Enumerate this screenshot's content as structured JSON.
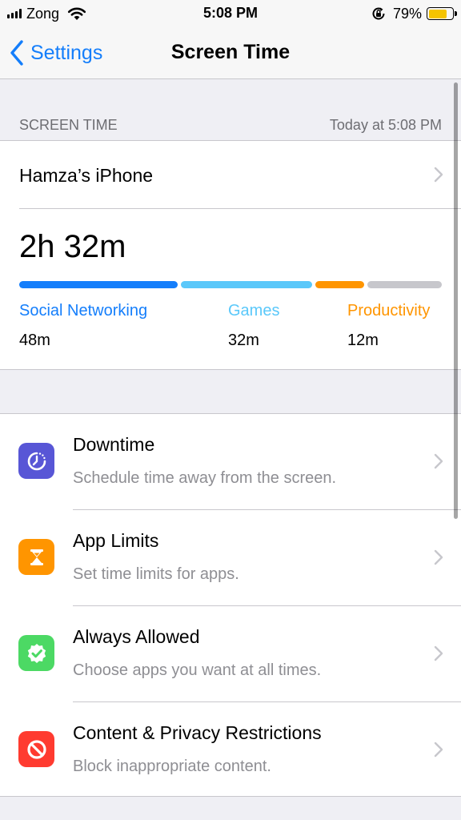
{
  "status_bar": {
    "carrier": "Zong",
    "time": "5:08 PM",
    "battery_percent": "79%",
    "battery_level": 0.79,
    "battery_color": "#f5c400",
    "icons": [
      "signal-icon",
      "wifi-icon",
      "orientation-lock-icon",
      "battery-icon"
    ]
  },
  "nav": {
    "back_label": "Settings",
    "title": "Screen Time"
  },
  "section": {
    "header": "SCREEN TIME",
    "updated": "Today at 5:08 PM"
  },
  "device": {
    "name": "Hamza’s iPhone",
    "total": "2h 32m",
    "categories": [
      {
        "label": "Social Networking",
        "value": "48m",
        "color": "#147efb"
      },
      {
        "label": "Games",
        "value": "32m",
        "color": "#5ac8fa"
      },
      {
        "label": "Productivity",
        "value": "12m",
        "color": "#ff9500"
      }
    ],
    "other_color": "#c7c7cc"
  },
  "options": [
    {
      "title": "Downtime",
      "subtitle": "Schedule time away from the screen.",
      "icon": "downtime-icon",
      "color": "#5856d6"
    },
    {
      "title": "App Limits",
      "subtitle": "Set time limits for apps.",
      "icon": "hourglass-icon",
      "color": "#ff9500"
    },
    {
      "title": "Always Allowed",
      "subtitle": "Choose apps you want at all times.",
      "icon": "checkmark-badge-icon",
      "color": "#4cd964"
    },
    {
      "title": "Content & Privacy Restrictions",
      "subtitle": "Block inappropriate content.",
      "icon": "restriction-icon",
      "color": "#ff3b30"
    }
  ]
}
